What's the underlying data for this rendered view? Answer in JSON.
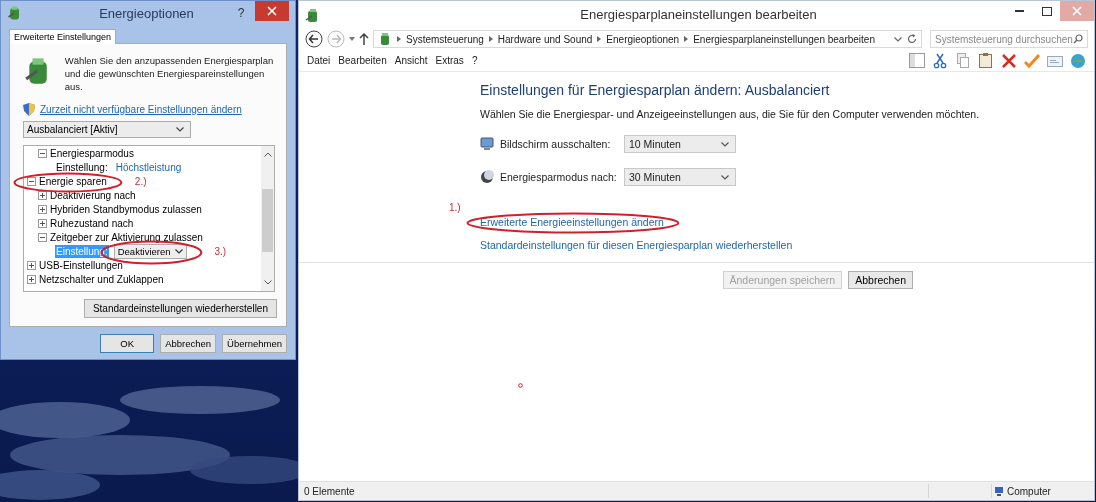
{
  "dialog": {
    "title": "Energieoptionen",
    "help_button": "?",
    "tabs": [
      {
        "label": "Erweiterte Einstellungen",
        "selected": true
      }
    ],
    "intro": "Wählen Sie den anzupassenden Energiesparplan und die gewünschten Energiespareinstellungen aus.",
    "link": "Zurzeit nicht verfügbare Einstellungen ändern",
    "plan_select": {
      "value": "Ausbalanciert [Aktiv]"
    },
    "tree": {
      "items": [
        {
          "children": [
            {
              "label": "Energiesparmodus",
              "expanded": true,
              "children": [
                {
                  "kind": "setting",
                  "label": "Einstellung:",
                  "value": "Höchstleistung",
                  "selected": false
                }
              ]
            }
          ]
        },
        {
          "label": "Energie sparen",
          "expanded": true,
          "annotation": "2.)",
          "children": [
            {
              "label": "Deaktivierung nach",
              "expanded": false
            },
            {
              "label": "Hybriden Standbymodus zulassen",
              "expanded": false
            },
            {
              "label": "Ruhezustand nach",
              "expanded": false
            },
            {
              "label": "Zeitgeber zur Aktivierung zulassen",
              "expanded": true,
              "children": [
                {
                  "kind": "dropdown",
                  "label": "Einstellung:",
                  "value": "Deaktivieren",
                  "selected": true,
                  "annotation": "3.)"
                }
              ]
            }
          ]
        },
        {
          "label": "USB-Einstellungen",
          "expanded": false
        },
        {
          "label": "Netzschalter und Zuklappen",
          "expanded": false
        }
      ]
    },
    "restore_button": "Standardeinstellungen wiederherstellen",
    "buttons": [
      "OK",
      "Abbrechen",
      "Übernehmen"
    ]
  },
  "editor": {
    "title": "Energiesparplaneinstellungen bearbeiten",
    "breadcrumb": [
      "Systemsteuerung",
      "Hardware und Sound",
      "Energieoptionen",
      "Energiesparplaneinstellungen bearbeiten"
    ],
    "search": {
      "placeholder": "Systemsteuerung durchsuchen"
    },
    "menu": [
      "Datei",
      "Bearbeiten",
      "Ansicht",
      "Extras",
      "?"
    ],
    "heading": "Einstellungen für Energiesparplan ändern: Ausbalanciert",
    "description": "Wählen Sie die Energiespar- und Anzeigeeinstellungen aus, die Sie für den Computer verwenden möchten.",
    "settings": [
      {
        "kind": "display",
        "label": "Bildschirm ausschalten:",
        "value": "10 Minuten"
      },
      {
        "kind": "sleep",
        "label": "Energiesparmodus nach:",
        "value": "30 Minuten"
      }
    ],
    "links": [
      {
        "label": "Erweiterte Energieeinstellungen ändern",
        "annotation": "1.)"
      },
      {
        "label": "Standardeinstellungen für diesen Energiesparplan wiederherstellen"
      }
    ],
    "buttons": [
      {
        "label": "Änderungen speichern",
        "disabled": true
      },
      {
        "label": "Abbrechen",
        "disabled": false
      }
    ],
    "status_bar": {
      "items": "0 Elemente",
      "location": "Computer"
    }
  }
}
